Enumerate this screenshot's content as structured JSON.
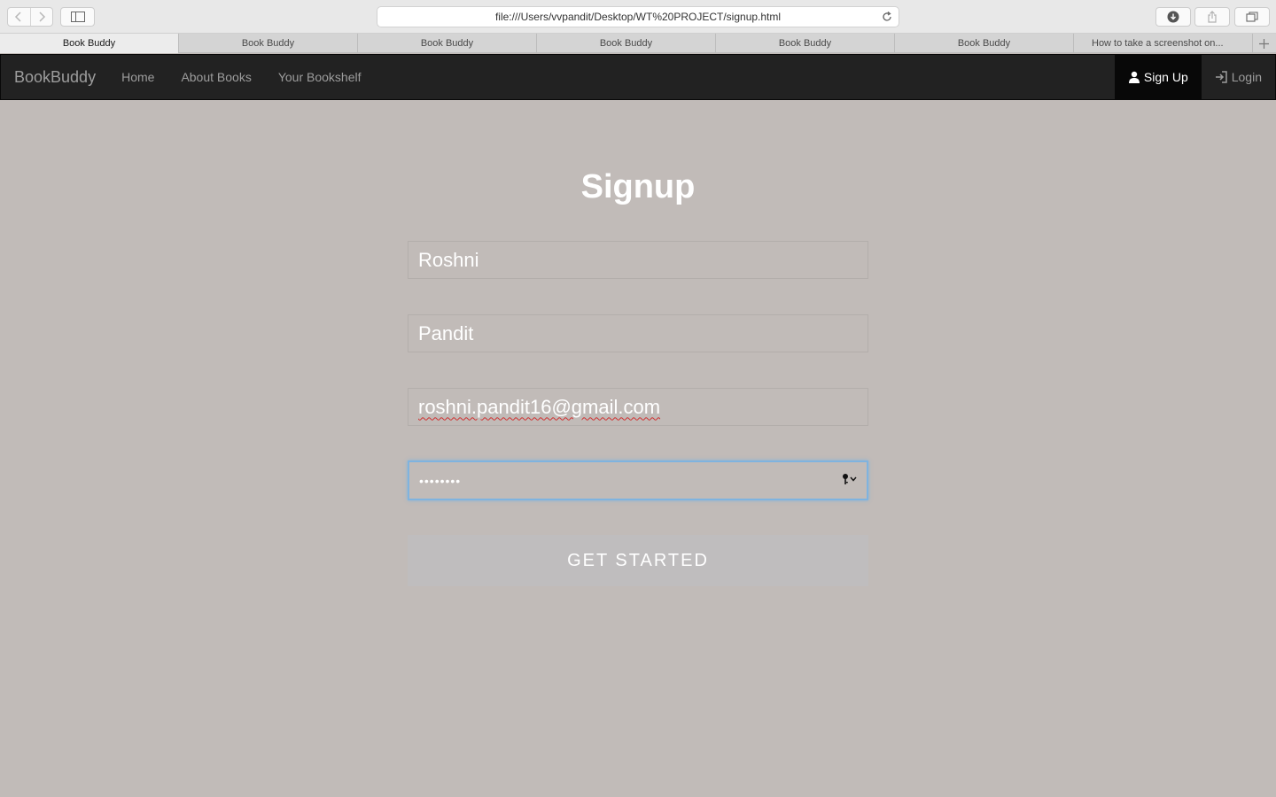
{
  "browser": {
    "url": "file:///Users/vvpandit/Desktop/WT%20PROJECT/signup.html",
    "tabs": [
      {
        "label": "Book Buddy",
        "active": true
      },
      {
        "label": "Book Buddy",
        "active": false
      },
      {
        "label": "Book Buddy",
        "active": false
      },
      {
        "label": "Book Buddy",
        "active": false
      },
      {
        "label": "Book Buddy",
        "active": false
      },
      {
        "label": "Book Buddy",
        "active": false
      },
      {
        "label": "How to take a screenshot on...",
        "active": false
      }
    ]
  },
  "navbar": {
    "brand": "BookBuddy",
    "links": [
      "Home",
      "About Books",
      "Your Bookshelf"
    ],
    "signup": "Sign Up",
    "login": "Login"
  },
  "form": {
    "title": "Signup",
    "first_name": "Roshni",
    "last_name": "Pandit",
    "email": "roshni.pandit16@gmail.com",
    "password_mask": "••••••••",
    "submit": "GET STARTED"
  },
  "colors": {
    "page_bg": "#c1bbb8",
    "navbar_bg": "#222222",
    "focus_ring": "#7fb3df"
  }
}
